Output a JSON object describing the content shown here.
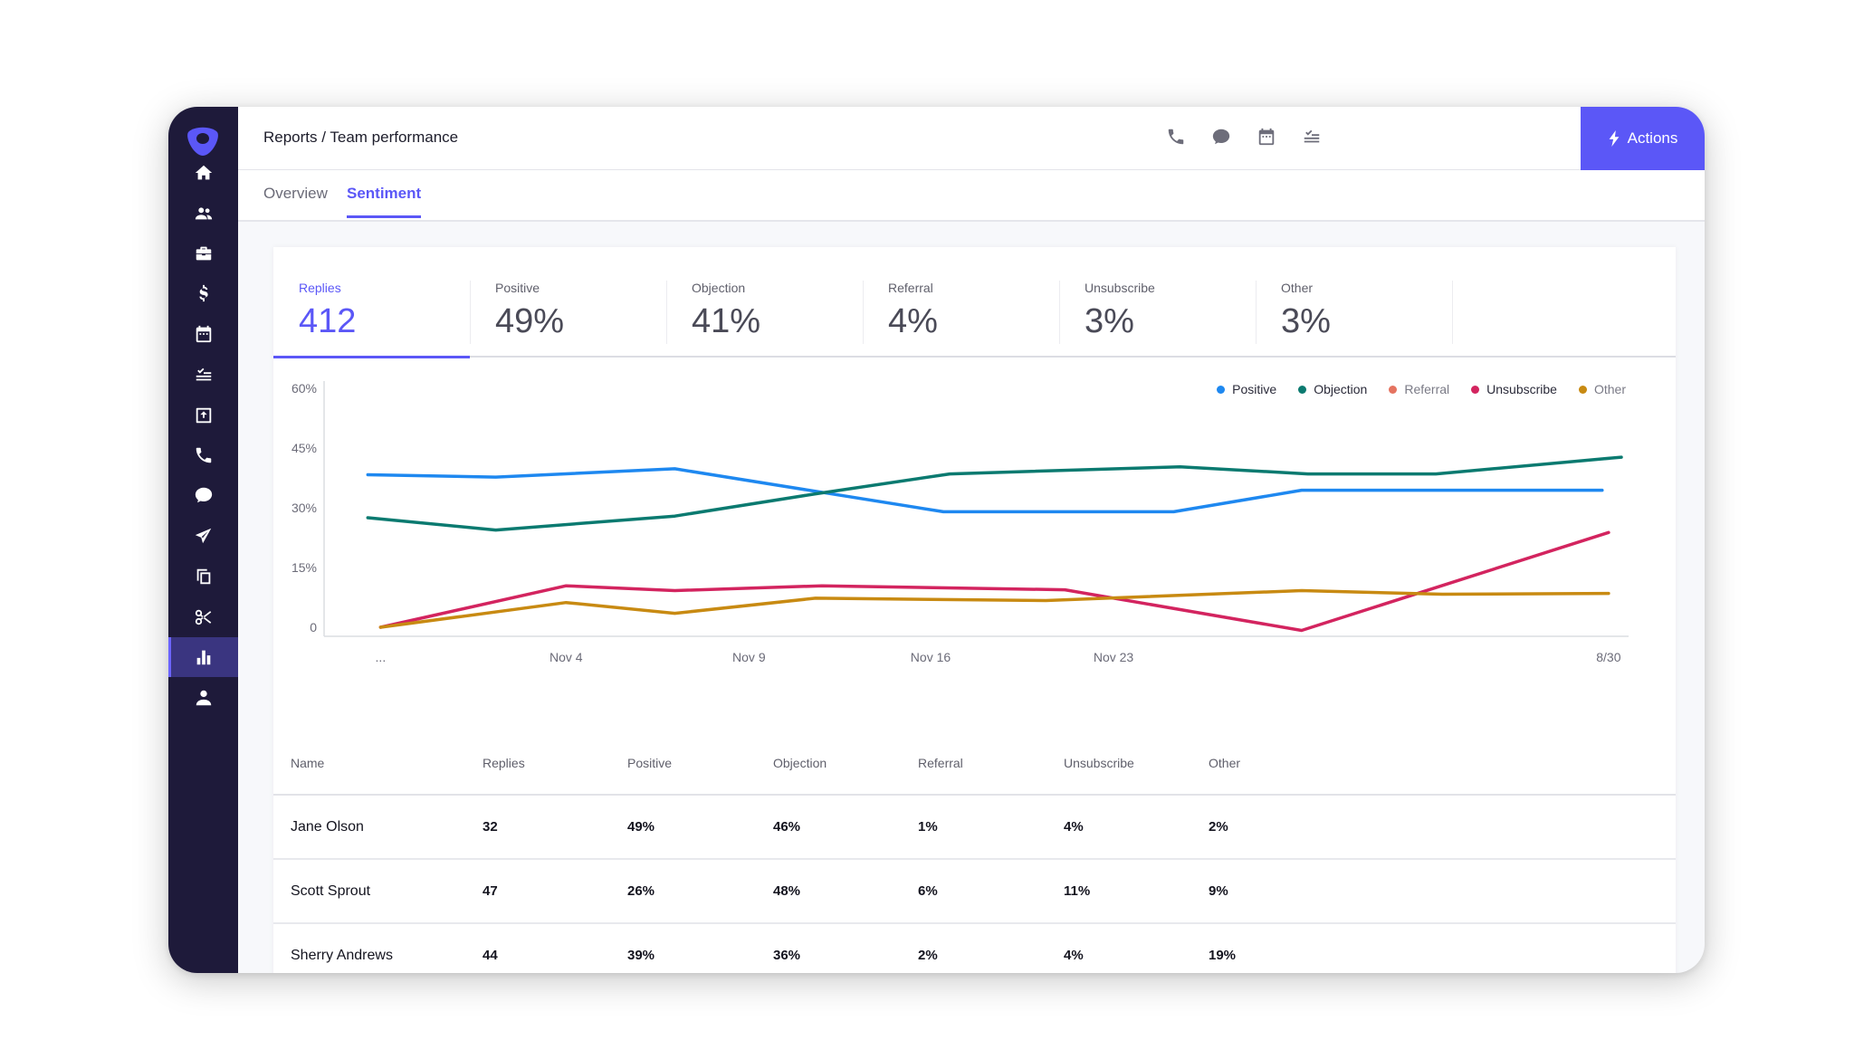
{
  "header": {
    "breadcrumb": "Reports / Team performance",
    "actions_label": "Actions",
    "icons": [
      "phone-icon",
      "chat-icon",
      "calendar-icon",
      "tasks-icon"
    ]
  },
  "sidebar": {
    "items": [
      {
        "name": "home",
        "icon": "home-icon"
      },
      {
        "name": "people",
        "icon": "people-icon"
      },
      {
        "name": "accounts",
        "icon": "briefcase-icon"
      },
      {
        "name": "deals",
        "icon": "dollar-icon"
      },
      {
        "name": "meetings",
        "icon": "calendar-icon"
      },
      {
        "name": "tasks",
        "icon": "tasks-icon"
      },
      {
        "name": "inbox",
        "icon": "inbox-upload-icon"
      },
      {
        "name": "calls",
        "icon": "phone-icon"
      },
      {
        "name": "chat",
        "icon": "chat-icon"
      },
      {
        "name": "send",
        "icon": "send-icon"
      },
      {
        "name": "templates",
        "icon": "copy-icon"
      },
      {
        "name": "snippets",
        "icon": "scissors-icon"
      },
      {
        "name": "reports",
        "icon": "bar-chart-icon",
        "active": true
      },
      {
        "name": "profile",
        "icon": "user-icon"
      }
    ]
  },
  "tabs": [
    {
      "label": "Overview",
      "active": false
    },
    {
      "label": "Sentiment",
      "active": true
    }
  ],
  "stats": [
    {
      "label": "Replies",
      "value": "412",
      "active": true
    },
    {
      "label": "Positive",
      "value": "49%"
    },
    {
      "label": "Objection",
      "value": "41%"
    },
    {
      "label": "Referral",
      "value": "4%"
    },
    {
      "label": "Unsubscribe",
      "value": "3%"
    },
    {
      "label": "Other",
      "value": "3%"
    }
  ],
  "chart_data": {
    "type": "line",
    "title": "",
    "xlabel": "",
    "ylabel": "",
    "ylim": [
      0,
      60
    ],
    "yticks": [
      "0",
      "15%",
      "30%",
      "45%",
      "60%"
    ],
    "ytick_values": [
      0,
      15,
      30,
      45,
      60
    ],
    "xticks": [
      "...",
      "Nov 4",
      "Nov 9",
      "Nov 16",
      "Nov 23",
      "8/30"
    ],
    "grid": false,
    "legend_position": "top-right",
    "series": [
      {
        "name": "Positive",
        "color": "#1e88f0",
        "muted": false,
        "points": [
          [
            0.02,
            38.3
          ],
          [
            0.12,
            37.7
          ],
          [
            0.26,
            39.8
          ],
          [
            0.47,
            29.0
          ],
          [
            0.65,
            29.0
          ],
          [
            0.75,
            34.4
          ],
          [
            0.985,
            34.4
          ]
        ]
      },
      {
        "name": "Objection",
        "color": "#0b7a70",
        "muted": false,
        "points": [
          [
            0.02,
            27.5
          ],
          [
            0.12,
            24.4
          ],
          [
            0.26,
            27.9
          ],
          [
            0.37,
            33.5
          ],
          [
            0.475,
            38.5
          ],
          [
            0.655,
            40.3
          ],
          [
            0.755,
            38.5
          ],
          [
            0.855,
            38.5
          ],
          [
            1.0,
            42.7
          ]
        ]
      },
      {
        "name": "Referral",
        "color": "#e57360",
        "muted": true,
        "points": []
      },
      {
        "name": "Unsubscribe",
        "color": "#d3245f",
        "muted": false,
        "points": [
          [
            0.03,
            0.0
          ],
          [
            0.175,
            10.4
          ],
          [
            0.26,
            9.2
          ],
          [
            0.375,
            10.4
          ],
          [
            0.565,
            9.4
          ],
          [
            0.75,
            -0.8
          ],
          [
            0.99,
            23.8
          ]
        ]
      },
      {
        "name": "Other",
        "color": "#c88a12",
        "muted": true,
        "points": [
          [
            0.03,
            0.0
          ],
          [
            0.175,
            6.2
          ],
          [
            0.26,
            3.5
          ],
          [
            0.37,
            7.3
          ],
          [
            0.55,
            6.7
          ],
          [
            0.75,
            9.2
          ],
          [
            0.86,
            8.3
          ],
          [
            0.99,
            8.5
          ]
        ]
      }
    ]
  },
  "table": {
    "columns": [
      "Name",
      "Replies",
      "Positive",
      "Objection",
      "Referral",
      "Unsubscribe",
      "Other"
    ],
    "rows": [
      [
        "Jane Olson",
        "32",
        "49%",
        "46%",
        "1%",
        "4%",
        "2%"
      ],
      [
        "Scott Sprout",
        "47",
        "26%",
        "48%",
        "6%",
        "11%",
        "9%"
      ],
      [
        "Sherry Andrews",
        "44",
        "39%",
        "36%",
        "2%",
        "4%",
        "19%"
      ]
    ]
  }
}
